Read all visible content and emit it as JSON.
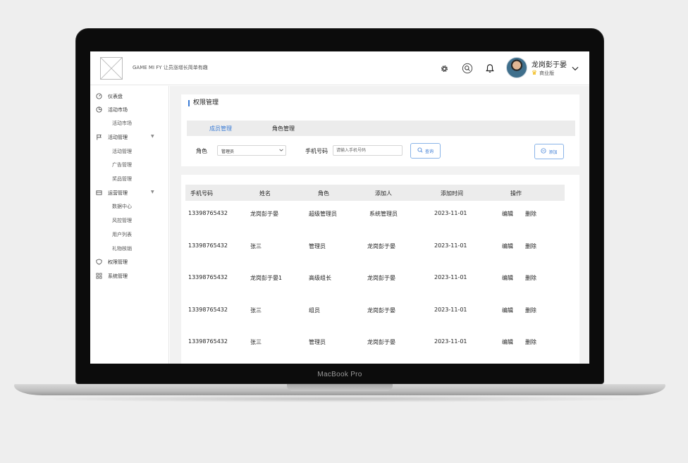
{
  "device": {
    "chin_label": "MacBook Pro"
  },
  "header": {
    "brand_text": "GAME MI FY 让员涨增长简单有趣",
    "user": {
      "name": "龙岗彭于晏",
      "tier": "商业版"
    }
  },
  "sidebar": {
    "items": [
      {
        "label": "仪表盘",
        "icon": "dashboard-icon",
        "level": 0
      },
      {
        "label": "活动市场",
        "icon": "market-icon",
        "level": 0
      },
      {
        "label": "活动市场",
        "level": 1
      },
      {
        "label": "活动管理",
        "icon": "flag-icon",
        "level": 0,
        "expandable": true
      },
      {
        "label": "活动管理",
        "level": 1
      },
      {
        "label": "广告管理",
        "level": 1
      },
      {
        "label": "奖品管理",
        "level": 1
      },
      {
        "label": "运营管理",
        "icon": "operations-icon",
        "level": 0,
        "expandable": true
      },
      {
        "label": "数据中心",
        "level": 1
      },
      {
        "label": "风控管理",
        "level": 1
      },
      {
        "label": "用户列表",
        "level": 1
      },
      {
        "label": "礼物核销",
        "level": 1
      },
      {
        "label": "权限管理",
        "icon": "shield-icon",
        "level": 0
      },
      {
        "label": "系统管理",
        "icon": "grid-icon",
        "level": 0
      }
    ]
  },
  "panel": {
    "title": "权限管理",
    "tabs": [
      {
        "label": "成员管理",
        "active": true
      },
      {
        "label": "角色管理",
        "active": false
      }
    ],
    "filters": {
      "role_label": "角色",
      "role_value": "管理员",
      "phone_label": "手机号码",
      "phone_placeholder": "请输入手机号码",
      "query_label": "查询",
      "add_label": "添加"
    }
  },
  "table": {
    "headers": [
      "手机号码",
      "姓名",
      "角色",
      "添加人",
      "添加时间",
      "操作"
    ],
    "rows": [
      {
        "phone": "13398765432",
        "name": "龙岗彭于晏",
        "role": "超级管理员",
        "added_by": "系统管理员",
        "added_at": "2023-11-01"
      },
      {
        "phone": "13398765432",
        "name": "张三",
        "role": "管理员",
        "added_by": "龙岗彭于晏",
        "added_at": "2023-11-01"
      },
      {
        "phone": "13398765432",
        "name": "龙岗彭于晏1",
        "role": "高级组长",
        "added_by": "龙岗彭于晏",
        "added_at": "2023-11-01"
      },
      {
        "phone": "13398765432",
        "name": "张三",
        "role": "组员",
        "added_by": "龙岗彭于晏",
        "added_at": "2023-11-01"
      },
      {
        "phone": "13398765432",
        "name": "张三",
        "role": "管理员",
        "added_by": "龙岗彭于晏",
        "added_at": "2023-11-01"
      }
    ],
    "actions": {
      "edit": "编辑",
      "delete": "删除"
    }
  },
  "colors": {
    "accent": "#3a7bd5",
    "panel_bg": "#f2f2f2",
    "header_row_bg": "#ececec"
  }
}
